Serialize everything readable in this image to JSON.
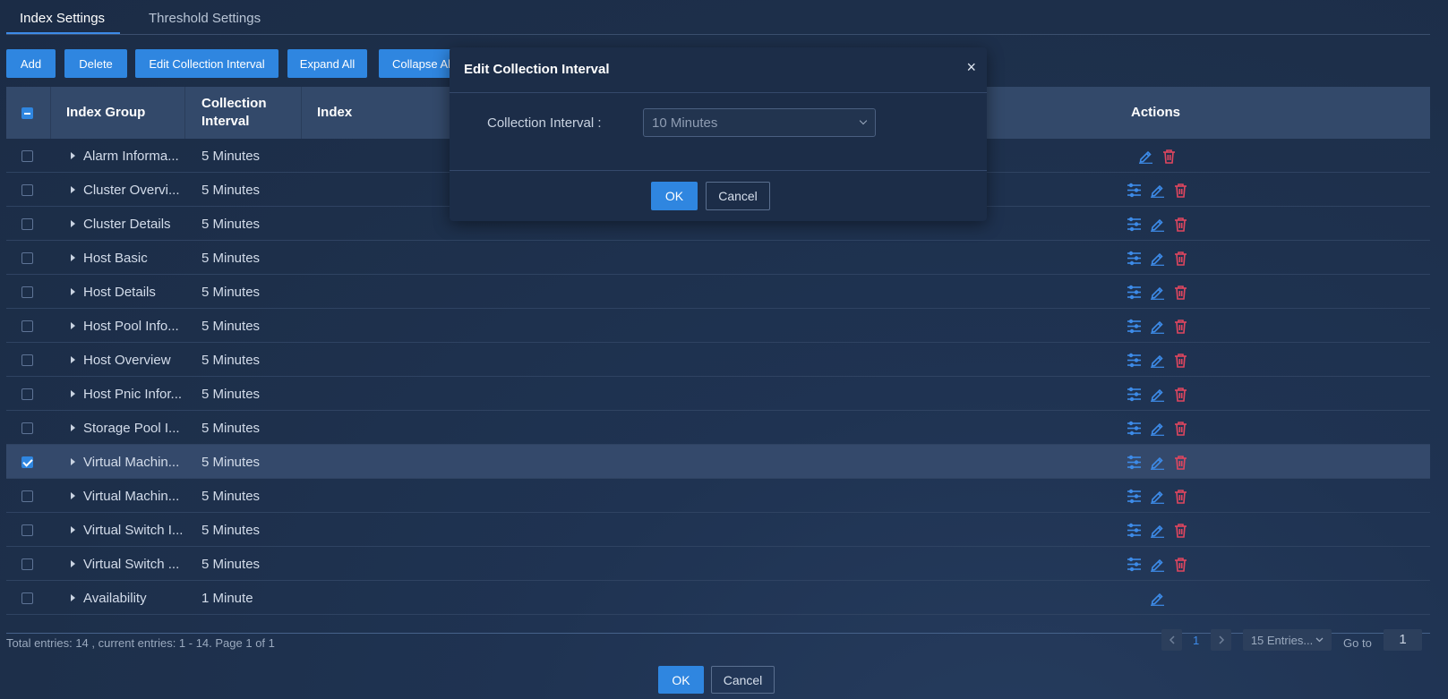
{
  "tabs": [
    {
      "label": "Index Settings",
      "active": true
    },
    {
      "label": "Threshold Settings",
      "active": false
    }
  ],
  "toolbar": {
    "add": "Add",
    "delete": "Delete",
    "edit_interval": "Edit Collection Interval",
    "expand_all": "Expand All",
    "collapse_all": "Collapse All"
  },
  "table": {
    "headers": {
      "index_group": "Index Group",
      "collection_interval": "Collection Interval",
      "index": "Index",
      "actions": "Actions"
    },
    "rows": [
      {
        "group": "Alarm Informa...",
        "interval": "5 Minutes",
        "checked": false,
        "icons": [
          "edit-icon",
          "delete-icon"
        ]
      },
      {
        "group": "Cluster Overvi...",
        "interval": "5 Minutes",
        "checked": false,
        "icons": [
          "settings-icon",
          "edit-icon",
          "delete-icon"
        ]
      },
      {
        "group": "Cluster Details",
        "interval": "5 Minutes",
        "checked": false,
        "icons": [
          "settings-icon",
          "edit-icon",
          "delete-icon"
        ]
      },
      {
        "group": "Host Basic",
        "interval": "5 Minutes",
        "checked": false,
        "icons": [
          "settings-icon",
          "edit-icon",
          "delete-icon"
        ]
      },
      {
        "group": "Host Details",
        "interval": "5 Minutes",
        "checked": false,
        "icons": [
          "settings-icon",
          "edit-icon",
          "delete-icon"
        ]
      },
      {
        "group": "Host Pool Info...",
        "interval": "5 Minutes",
        "checked": false,
        "icons": [
          "settings-icon",
          "edit-icon",
          "delete-icon"
        ]
      },
      {
        "group": "Host Overview",
        "interval": "5 Minutes",
        "checked": false,
        "icons": [
          "settings-icon",
          "edit-icon",
          "delete-icon"
        ]
      },
      {
        "group": "Host Pnic Infor...",
        "interval": "5 Minutes",
        "checked": false,
        "icons": [
          "settings-icon",
          "edit-icon",
          "delete-icon"
        ]
      },
      {
        "group": "Storage Pool I...",
        "interval": "5 Minutes",
        "checked": false,
        "icons": [
          "settings-icon",
          "edit-icon",
          "delete-icon"
        ]
      },
      {
        "group": "Virtual Machin...",
        "interval": "5 Minutes",
        "checked": true,
        "icons": [
          "settings-icon",
          "edit-icon",
          "delete-icon"
        ]
      },
      {
        "group": "Virtual Machin...",
        "interval": "5 Minutes",
        "checked": false,
        "icons": [
          "settings-icon",
          "edit-icon",
          "delete-icon"
        ]
      },
      {
        "group": "Virtual Switch I...",
        "interval": "5 Minutes",
        "checked": false,
        "icons": [
          "settings-icon",
          "edit-icon",
          "delete-icon"
        ]
      },
      {
        "group": "Virtual Switch ...",
        "interval": "5 Minutes",
        "checked": false,
        "icons": [
          "settings-icon",
          "edit-icon",
          "delete-icon"
        ]
      },
      {
        "group": "Availability",
        "interval": "1 Minute",
        "checked": false,
        "icons": [
          "edit-icon"
        ]
      }
    ]
  },
  "footer": {
    "summary": "Total entries: 14 , current entries: 1 - 14. Page 1 of 1",
    "current_page": "1",
    "page_size": "15 Entries...",
    "goto_label": "Go to",
    "goto_value": "1",
    "ok": "OK",
    "cancel": "Cancel"
  },
  "modal": {
    "title": "Edit Collection Interval",
    "close": "×",
    "field_label": "Collection Interval :",
    "field_value": "10 Minutes",
    "ok": "OK",
    "cancel": "Cancel"
  },
  "colors": {
    "accent": "#2f86e0",
    "edit_icon": "#3d8be8",
    "delete_icon": "#e0465f",
    "background": "#1e3049"
  }
}
